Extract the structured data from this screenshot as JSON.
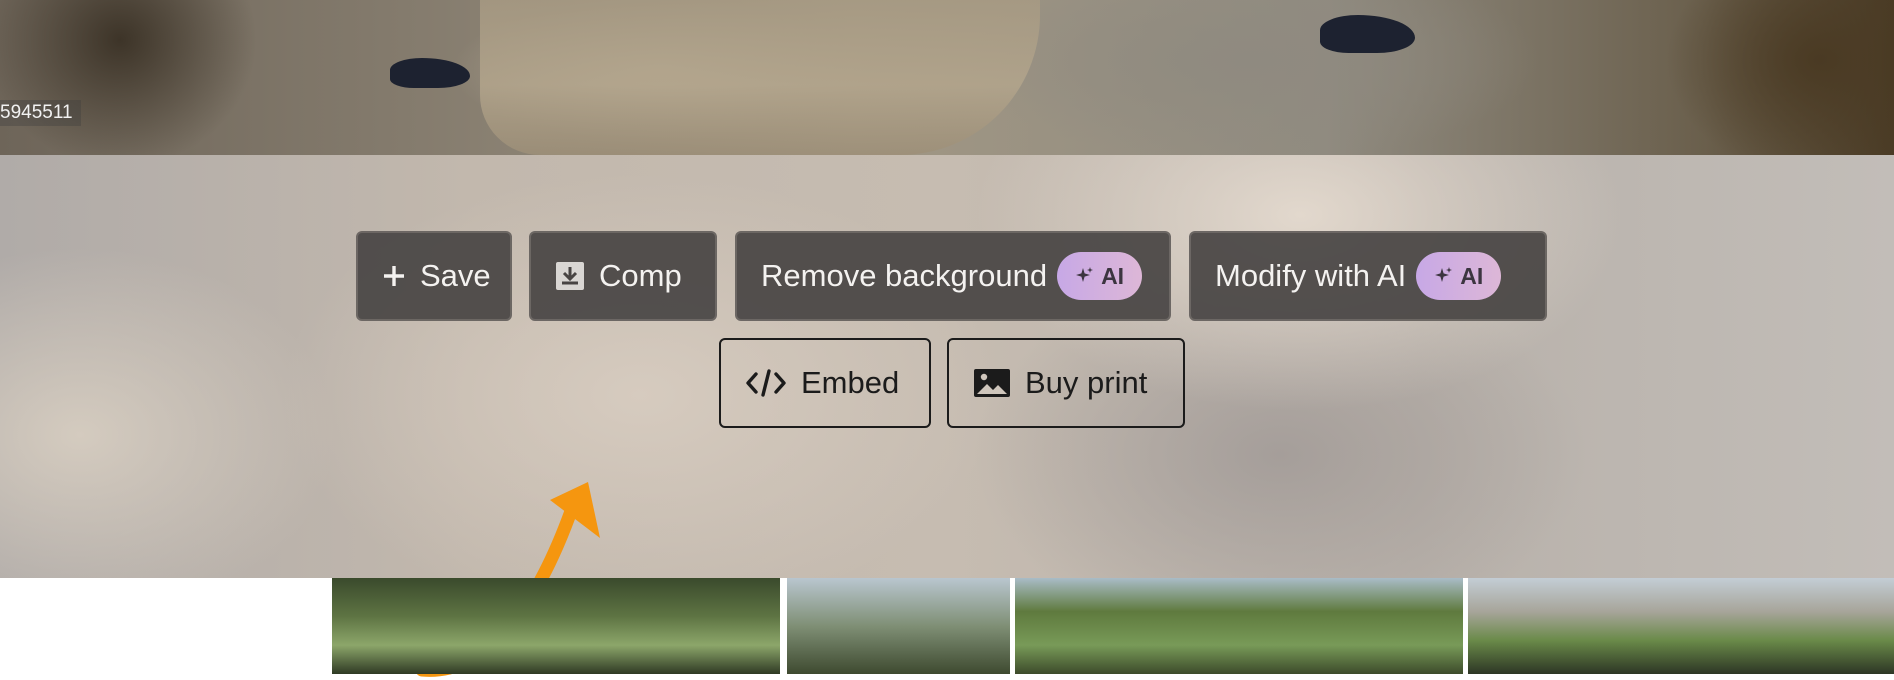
{
  "photo": {
    "id_text": "5945511"
  },
  "actions": {
    "save_label": "Save",
    "comp_label": "Comp",
    "remove_bg_label": "Remove background",
    "modify_ai_label": "Modify with AI",
    "ai_badge_label": "AI",
    "embed_label": "Embed",
    "buy_print_label": "Buy print"
  },
  "icons": [
    "plus-icon",
    "download-icon",
    "sparkle-icon",
    "code-icon",
    "image-icon",
    "arrow-annotation"
  ],
  "colors": {
    "dark_button_bg": "#484443",
    "ai_badge_gradient_start": "#c7a8e6",
    "ai_badge_gradient_end": "#ddb7d7",
    "annotation_arrow": "#f5960f"
  }
}
